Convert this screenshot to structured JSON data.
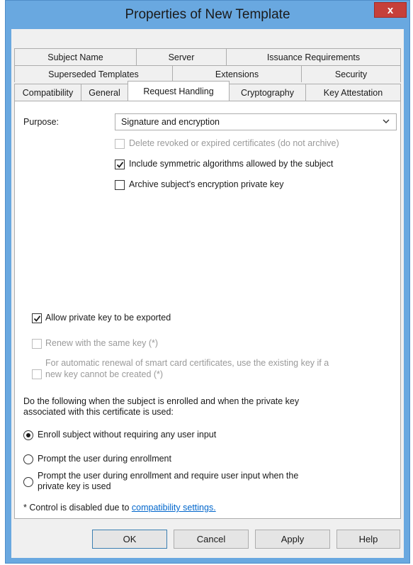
{
  "window": {
    "title": "Properties of New Template",
    "close_label": "x"
  },
  "tabs": {
    "row1": [
      "Subject Name",
      "Server",
      "Issuance Requirements"
    ],
    "row2": [
      "Superseded Templates",
      "Extensions",
      "Security"
    ],
    "row3": [
      "Compatibility",
      "General",
      "Request Handling",
      "Cryptography",
      "Key Attestation"
    ],
    "active": "Request Handling"
  },
  "purpose": {
    "label": "Purpose:",
    "value": "Signature and encryption"
  },
  "options": {
    "delete_revoked": {
      "label": "Delete revoked or expired certificates (do not archive)",
      "checked": false,
      "enabled": false
    },
    "include_symmetric": {
      "label": "Include symmetric algorithms allowed by the subject",
      "checked": true,
      "enabled": true
    },
    "archive_key": {
      "label": "Archive subject's encryption private key",
      "checked": false,
      "enabled": true
    },
    "allow_export": {
      "label": "Allow private key to be exported",
      "checked": true,
      "enabled": true
    },
    "renew_same_key": {
      "label": "Renew with the same key (*)",
      "checked": false,
      "enabled": false
    },
    "auto_renewal_line1": "For automatic renewal of smart card certificates, use the existing key if a",
    "auto_renewal_line2": "new key cannot be created (*)"
  },
  "enrollment": {
    "instruction_line1": "Do the following when the subject is enrolled and when the private key",
    "instruction_line2": "associated with this certificate is used:",
    "radio_enroll": "Enroll subject without requiring any user input",
    "radio_prompt": "Prompt the user during enrollment",
    "radio_prompt_require_line1": "Prompt the user during enrollment and require user input when the",
    "radio_prompt_require_line2": "private key is used",
    "selected": "radio_enroll"
  },
  "footnote": {
    "text": "* Control is disabled due to ",
    "link": "compatibility settings."
  },
  "buttons": {
    "ok": "OK",
    "cancel": "Cancel",
    "apply": "Apply",
    "help": "Help"
  }
}
